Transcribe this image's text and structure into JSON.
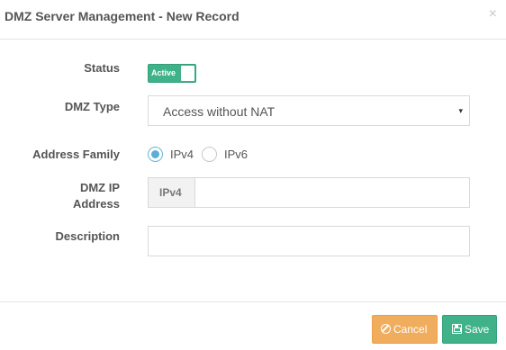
{
  "modal": {
    "title": "DMZ Server Management - New Record",
    "close_symbol": "×"
  },
  "form": {
    "status": {
      "label": "Status",
      "toggle_text": "Active",
      "enabled": true
    },
    "dmz_type": {
      "label": "DMZ Type",
      "selected": "Access without NAT",
      "caret": "▾"
    },
    "address_family": {
      "label": "Address Family",
      "options": [
        {
          "label": "IPv4",
          "checked": true
        },
        {
          "label": "IPv6",
          "checked": false
        }
      ]
    },
    "dmz_ip": {
      "label_line1": "DMZ IP",
      "label_line2": "Address",
      "addon": "IPv4",
      "value": ""
    },
    "description": {
      "label": "Description",
      "value": ""
    }
  },
  "footer": {
    "cancel_label": "Cancel",
    "save_label": "Save"
  },
  "colors": {
    "accent_green": "#3fb28a",
    "cancel_orange": "#f0ad5e",
    "radio_blue": "#5aaed8"
  },
  "icons": {
    "close": "close-icon",
    "caret": "chevron-down-icon",
    "cancel": "ban-icon",
    "save": "floppy-disk-icon"
  }
}
